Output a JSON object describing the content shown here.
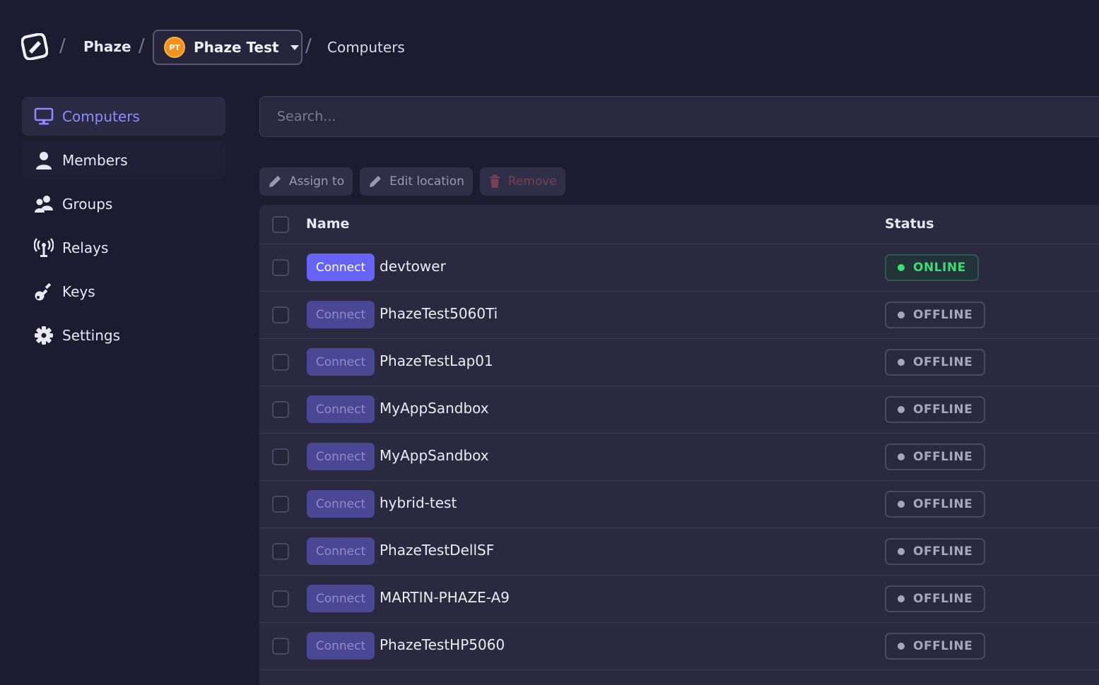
{
  "breadcrumb": {
    "org": "Phaze",
    "team": {
      "initials": "PT",
      "name": "Phaze Test"
    },
    "current": "Computers",
    "separator": "/"
  },
  "sidebar": {
    "items": [
      {
        "label": "Computers",
        "icon": "monitor-icon",
        "active": true
      },
      {
        "label": "Members",
        "icon": "user-icon"
      },
      {
        "label": "Groups",
        "icon": "users-icon"
      },
      {
        "label": "Relays",
        "icon": "antenna-icon"
      },
      {
        "label": "Keys",
        "icon": "key-icon"
      },
      {
        "label": "Settings",
        "icon": "gear-icon"
      }
    ]
  },
  "search": {
    "placeholder": "Search..."
  },
  "actions": {
    "assign": "Assign to",
    "edit_location": "Edit location",
    "remove": "Remove"
  },
  "table": {
    "headers": {
      "name": "Name",
      "status": "Status"
    },
    "connect_label": "Connect",
    "rows": [
      {
        "name": "devtower",
        "status": "ONLINE"
      },
      {
        "name": "PhazeTest5060Ti",
        "status": "OFFLINE"
      },
      {
        "name": "PhazeTestLap01",
        "status": "OFFLINE"
      },
      {
        "name": "MyAppSandbox",
        "status": "OFFLINE"
      },
      {
        "name": "MyAppSandbox",
        "status": "OFFLINE"
      },
      {
        "name": "hybrid-test",
        "status": "OFFLINE"
      },
      {
        "name": "PhazeTestDellSF",
        "status": "OFFLINE"
      },
      {
        "name": "MARTIN-PHAZE-A9",
        "status": "OFFLINE"
      },
      {
        "name": "PhazeTestHP5060",
        "status": "OFFLINE"
      }
    ]
  },
  "colors": {
    "accent": "#6664f5",
    "online": "#3fdc6f",
    "team_avatar": "#f4911b"
  }
}
